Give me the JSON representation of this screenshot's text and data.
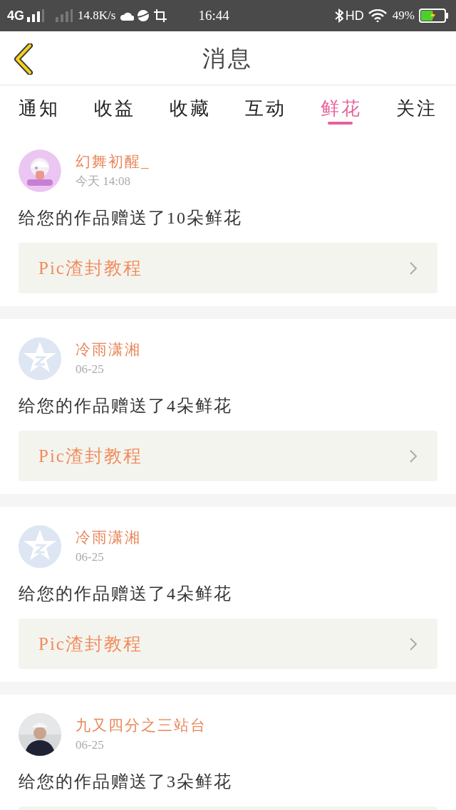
{
  "status_bar": {
    "network": "4G",
    "speed": "14.8K/s",
    "time": "16:44",
    "hd": "HD",
    "battery": "49%"
  },
  "header": {
    "title": "消息"
  },
  "tabs": [
    {
      "label": "通知",
      "selected": false
    },
    {
      "label": "收益",
      "selected": false
    },
    {
      "label": "收藏",
      "selected": false
    },
    {
      "label": "互动",
      "selected": false
    },
    {
      "label": "鲜花",
      "selected": true
    },
    {
      "label": "关注",
      "selected": false
    }
  ],
  "messages": [
    {
      "name": "幻舞初醒_",
      "time": "今天 14:08",
      "text": "给您的作品赠送了10朵鲜花",
      "link": "Pic渣封教程"
    },
    {
      "avatar": {
        "kind": "default"
      },
      "name": "冷雨潇湘",
      "time": "06-25",
      "text": "给您的作品赠送了4朵鲜花",
      "link": "Pic渣封教程"
    },
    {
      "avatar": {
        "kind": "default"
      },
      "name": "冷雨潇湘",
      "time": "06-25",
      "text": "给您的作品赠送了4朵鲜花",
      "link": "Pic渣封教程"
    },
    {
      "avatar": {
        "kind": "person"
      },
      "name": "九又四分之三站台",
      "time": "06-25",
      "text": "给您的作品赠送了3朵鲜花"
    }
  ]
}
